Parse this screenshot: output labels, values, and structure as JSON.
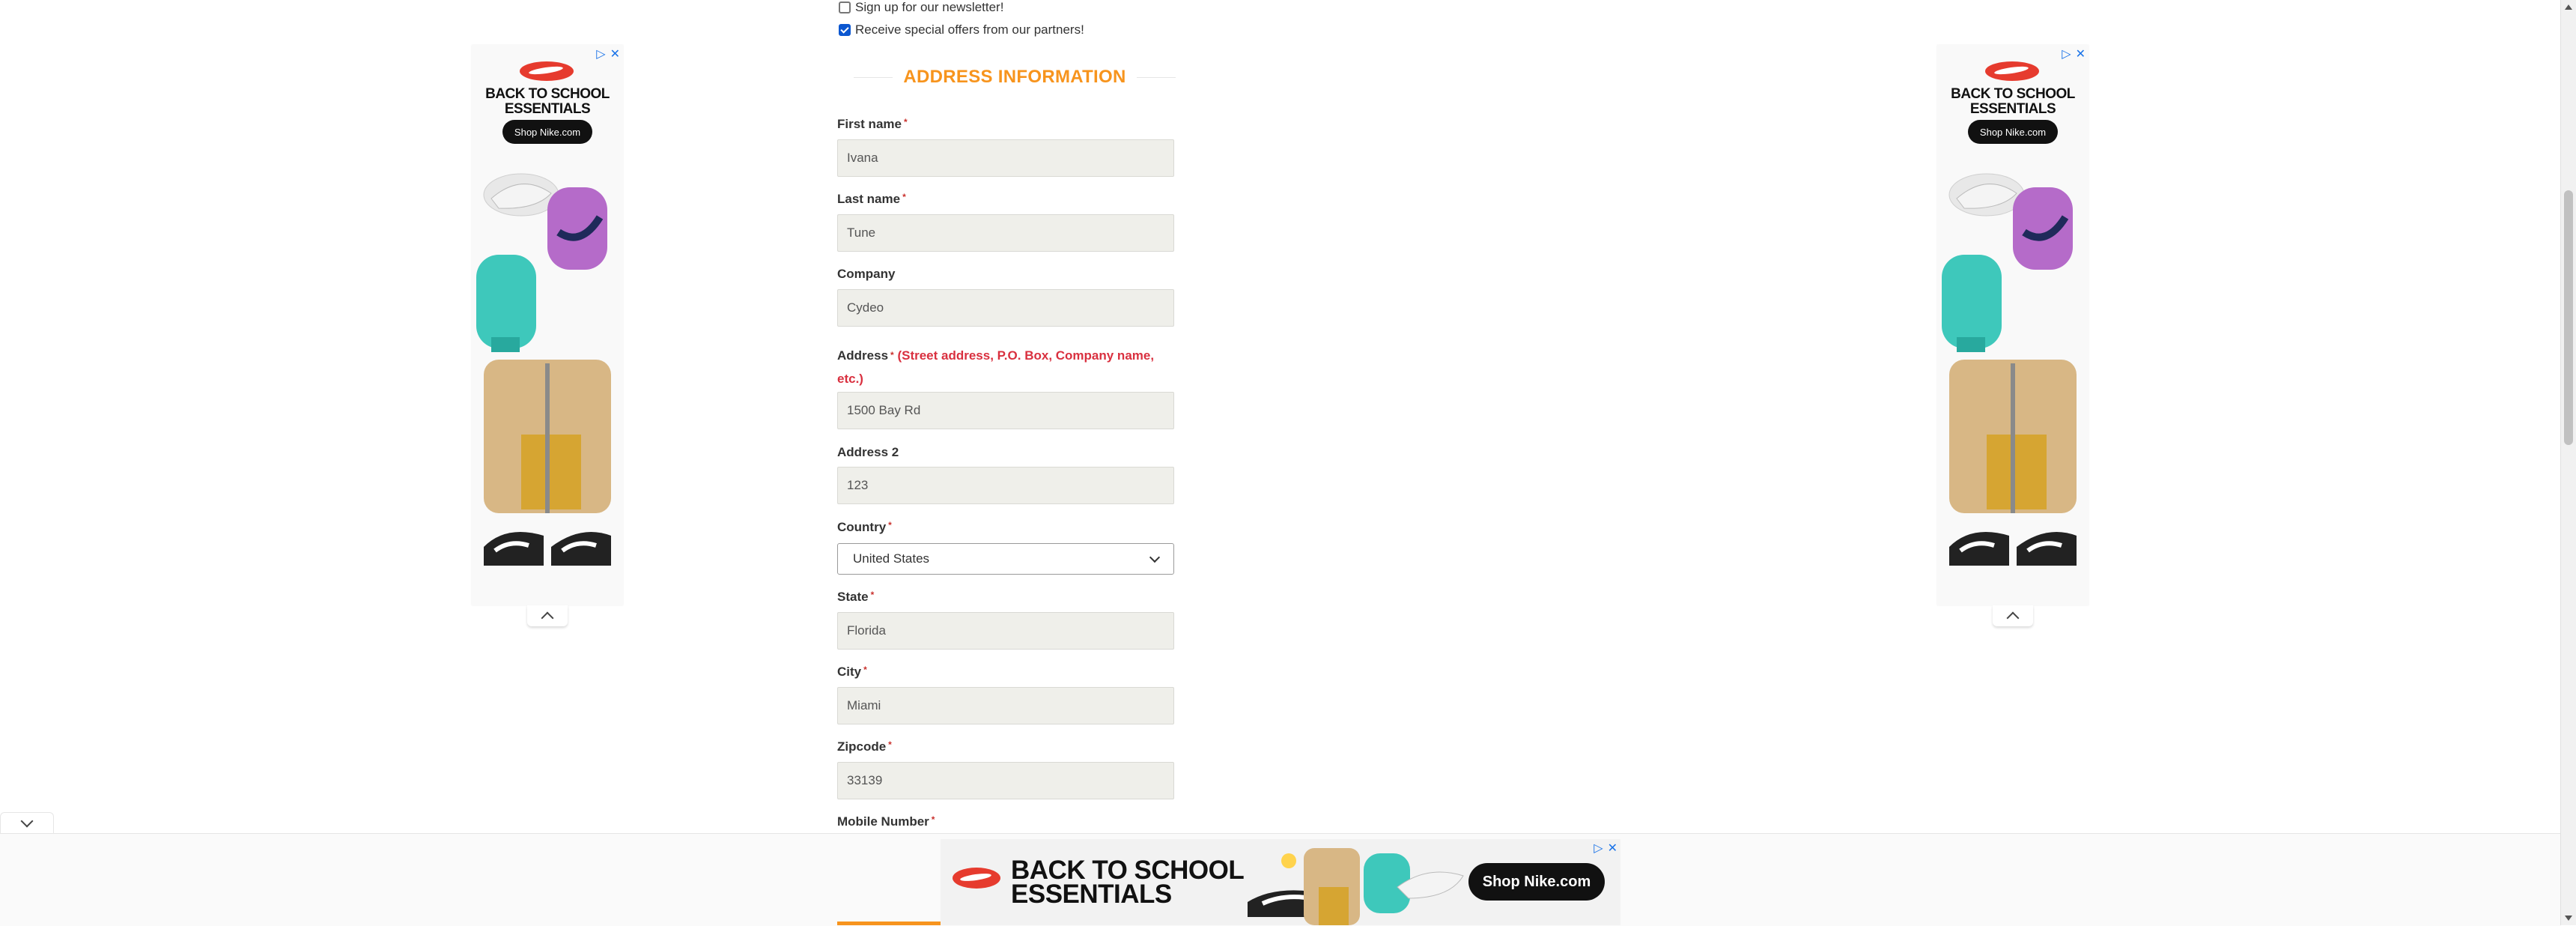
{
  "checkboxes": [
    {
      "label": "Sign up for our newsletter!",
      "checked": false
    },
    {
      "label": "Receive special offers from our partners!",
      "checked": true
    }
  ],
  "section_title": "ADDRESS INFORMATION",
  "required_mark": "*",
  "fields": {
    "first_name": {
      "label": "First name",
      "value": "Ivana"
    },
    "last_name": {
      "label": "Last name",
      "value": "Tune"
    },
    "company": {
      "label": "Company",
      "value": "Cydeo"
    },
    "address": {
      "label": "Address",
      "hint": "(Street address, P.O. Box, Company name,",
      "hint2": "etc.)",
      "value": "1500 Bay Rd"
    },
    "address2": {
      "label": "Address 2",
      "value": "123"
    },
    "country": {
      "label": "Country",
      "value": "United States"
    },
    "state": {
      "label": "State",
      "value": "Florida"
    },
    "city": {
      "label": "City",
      "value": "Miami"
    },
    "zipcode": {
      "label": "Zipcode",
      "value": "33139"
    },
    "mobile": {
      "label": "Mobile Number"
    }
  },
  "ads": {
    "side_headline_1": "BACK TO SCHOOL",
    "side_headline_2": "ESSENTIALS",
    "side_button": "Shop Nike.com",
    "bottom_headline_1": "BACK TO SCHOOL",
    "bottom_headline_2": "ESSENTIALS",
    "bottom_button": "Shop Nike.com",
    "adchoices_icon": "▷",
    "close_icon": "✕"
  },
  "colors": {
    "accent_orange": "#f7941d",
    "hint_red": "#d9303f",
    "nike_red": "#e63b2e",
    "input_bg": "#efefea"
  }
}
